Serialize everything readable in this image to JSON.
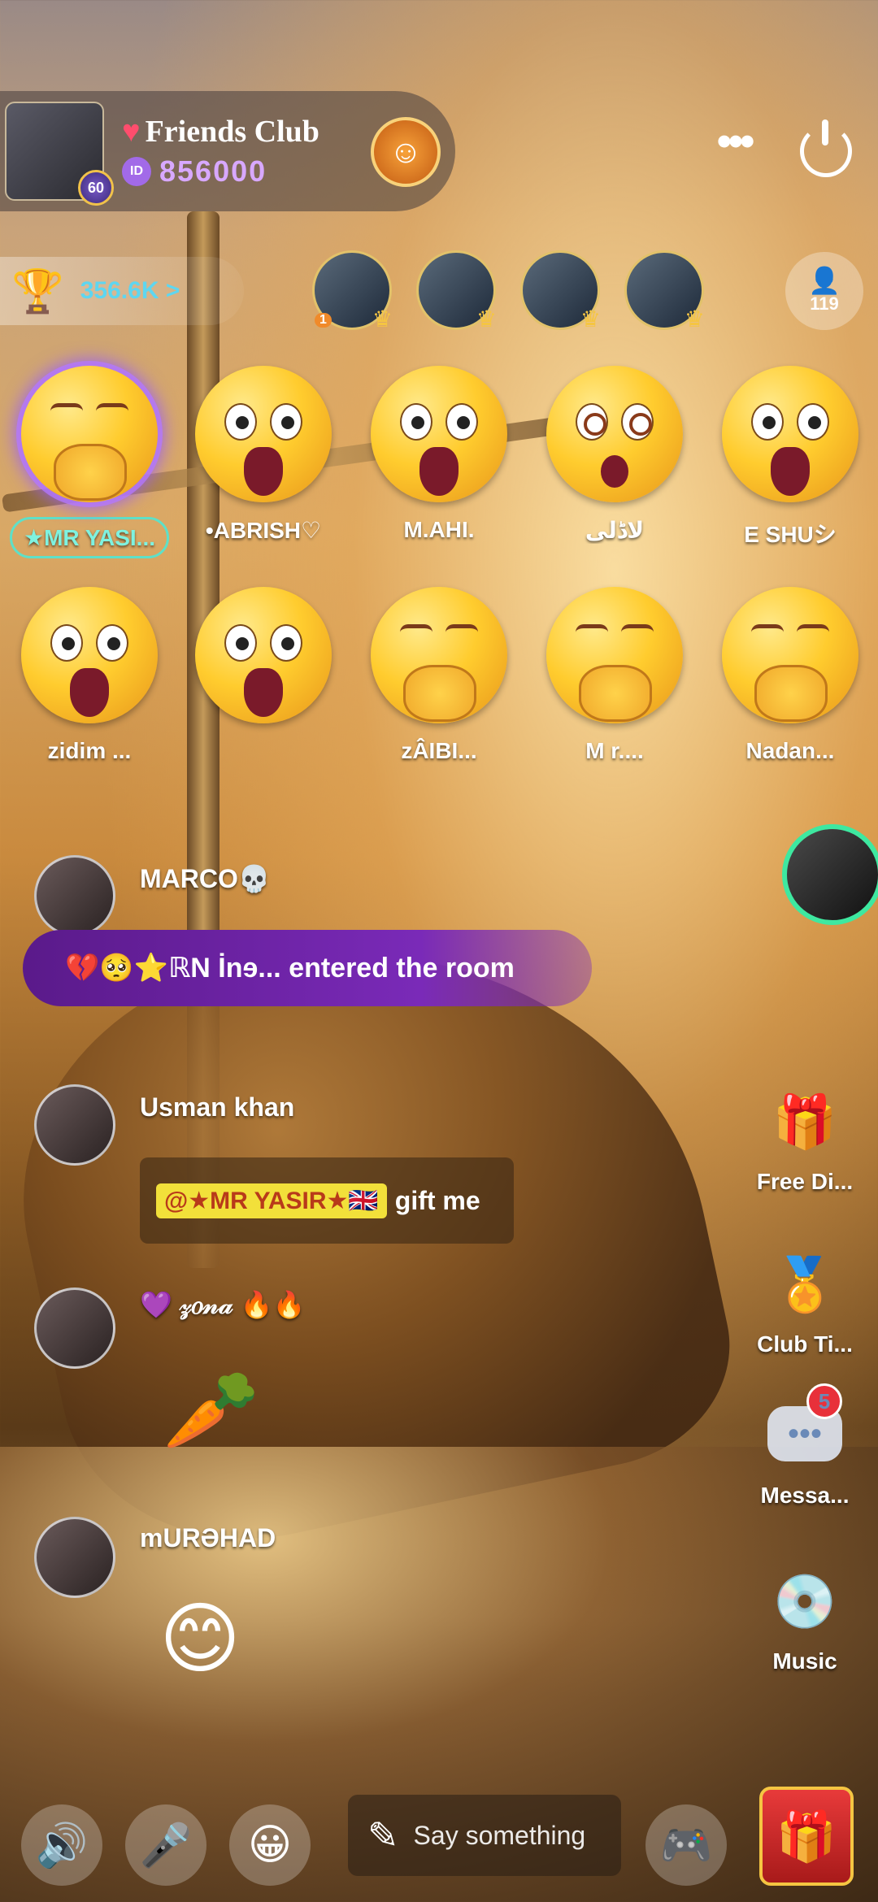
{
  "room": {
    "title": "Friends Club",
    "id": "856000",
    "id_badge": "ID",
    "level": "60"
  },
  "header": {
    "more_icon": "more-dots-icon",
    "power_icon": "power-icon"
  },
  "trophy": {
    "value": "356.6K >",
    "icon": "trophy-icon"
  },
  "top_viewers": [
    {
      "rank": "1"
    },
    {
      "rank": ""
    },
    {
      "rank": ""
    },
    {
      "rank": ""
    }
  ],
  "audience_count": "119",
  "seats": [
    {
      "name": "★MR YASI...",
      "face": "shy",
      "highlight": true
    },
    {
      "name": "•ABRISH♡",
      "face": "shock"
    },
    {
      "name": "M.AHI.",
      "face": "shock"
    },
    {
      "name": "لاڈلی",
      "face": "spiral"
    },
    {
      "name": "E SHUシ",
      "face": "shock"
    },
    {
      "name": "zidim ...",
      "face": "shock"
    },
    {
      "name": "",
      "face": "shock"
    },
    {
      "name": "zÂIBI...",
      "face": "shy"
    },
    {
      "name": "M r....",
      "face": "shy"
    },
    {
      "name": "Nadan...",
      "face": "shy"
    }
  ],
  "chat": {
    "marco_name": "MARCO💀",
    "entered": "💔🥺⭐ℝN İnɘ... entered the room",
    "usman_name": "Usman khan",
    "gift_mention": "@★MR YASIR★🇬🇧",
    "gift_text": "gift me",
    "third_name": "💜 𝓏𝑜𝓃𝒶 🔥🔥",
    "murshad_name": "mURƏHAD"
  },
  "side_panel": {
    "free_diamond_label": "Free Di...",
    "club_title_label": "Club Ti...",
    "messages_label": "Messa...",
    "messages_badge": "5",
    "music_label": "Music"
  },
  "bottom_bar": {
    "speaker_icon": "speaker-icon",
    "mic_icon": "mic-icon",
    "emoji_icon": "emoji-icon",
    "say_placeholder": "Say something",
    "game_icon": "gamepad-icon",
    "gift_icon": "gift-icon"
  }
}
